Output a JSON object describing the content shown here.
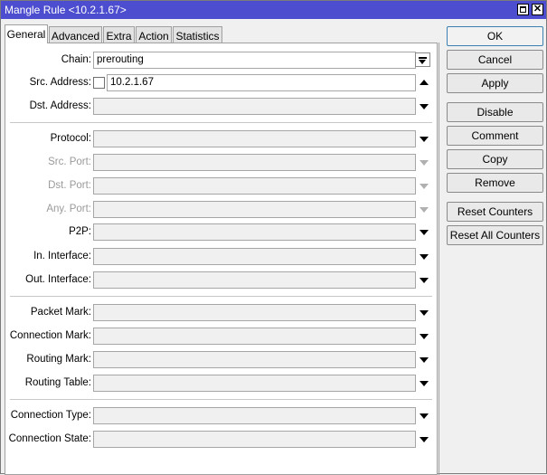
{
  "window": {
    "title": "Mangle Rule <10.2.1.67>"
  },
  "tabs": [
    "General",
    "Advanced",
    "Extra",
    "Action",
    "Statistics"
  ],
  "fields": {
    "chain": {
      "label": "Chain:",
      "value": "prerouting"
    },
    "src_address": {
      "label": "Src. Address:",
      "value": "10.2.1.67"
    },
    "dst_address": {
      "label": "Dst. Address:"
    },
    "protocol": {
      "label": "Protocol:"
    },
    "src_port": {
      "label": "Src. Port:"
    },
    "dst_port": {
      "label": "Dst. Port:"
    },
    "any_port": {
      "label": "Any. Port:"
    },
    "p2p": {
      "label": "P2P:"
    },
    "in_interface": {
      "label": "In. Interface:"
    },
    "out_interface": {
      "label": "Out. Interface:"
    },
    "packet_mark": {
      "label": "Packet Mark:"
    },
    "connection_mark": {
      "label": "Connection Mark:"
    },
    "routing_mark": {
      "label": "Routing Mark:"
    },
    "routing_table": {
      "label": "Routing Table:"
    },
    "connection_type": {
      "label": "Connection Type:"
    },
    "connection_state": {
      "label": "Connection State:"
    }
  },
  "buttons": {
    "ok": "OK",
    "cancel": "Cancel",
    "apply": "Apply",
    "disable": "Disable",
    "comment": "Comment",
    "copy": "Copy",
    "remove": "Remove",
    "reset_counters": "Reset Counters",
    "reset_all_counters": "Reset All Counters"
  },
  "colors": {
    "titlebar": "#4d4dcf",
    "disabled_label": "#9a9a9a"
  }
}
